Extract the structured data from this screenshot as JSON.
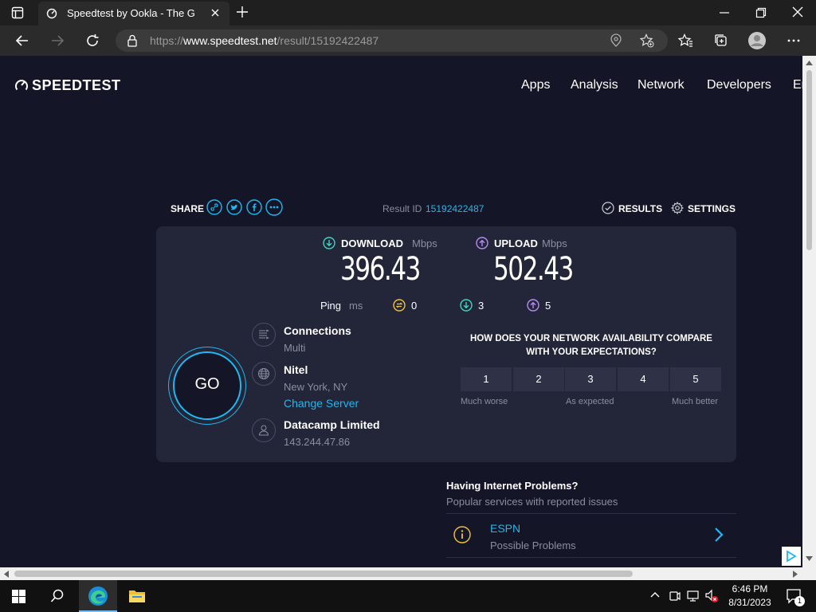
{
  "browser": {
    "tab_title": "Speedtest by Ookla - The Global",
    "url_prefix": "https://",
    "url_host": "www.speedtest.net",
    "url_path": "/result/15192422487"
  },
  "site": {
    "logo_text": "SPEEDTEST",
    "nav": [
      "Apps",
      "Analysis",
      "Network",
      "Developers",
      "Er"
    ]
  },
  "result": {
    "share_label": "SHARE",
    "result_id_label": "Result ID",
    "result_id": "15192422487",
    "results_label": "RESULTS",
    "settings_label": "SETTINGS",
    "download_label": "DOWNLOAD",
    "upload_label": "UPLOAD",
    "unit": "Mbps",
    "download_value": "396.43",
    "upload_value": "502.43",
    "ping_label": "Ping",
    "ping_unit": "ms",
    "ping_idle": "0",
    "ping_download": "3",
    "ping_upload": "5",
    "go_label": "GO",
    "connections_label": "Connections",
    "connections_value": "Multi",
    "server_name": "Nitel",
    "server_location": "New York, NY",
    "change_server": "Change Server",
    "isp_name": "Datacamp Limited",
    "isp_ip": "143.244.47.86",
    "question_line1": "HOW DOES YOUR NETWORK AVAILABILITY COMPARE",
    "question_line2": "WITH YOUR EXPECTATIONS?",
    "ratings": [
      "1",
      "2",
      "3",
      "4",
      "5"
    ],
    "rating_low": "Much worse",
    "rating_mid": "As expected",
    "rating_high": "Much better"
  },
  "problems": {
    "title": "Having Internet Problems?",
    "subtitle": "Popular services with reported issues",
    "service_name": "ESPN",
    "service_status": "Possible Problems"
  },
  "taskbar": {
    "time": "6:46 PM",
    "date": "8/31/2023",
    "notification_count": "1"
  },
  "colors": {
    "page_bg": "#141526",
    "panel_bg": "#232538",
    "accent_link": "#1fb8f0",
    "download_icon": "#3dd6c0",
    "upload_icon": "#b58cf5",
    "idle_icon": "#f0c33c"
  }
}
